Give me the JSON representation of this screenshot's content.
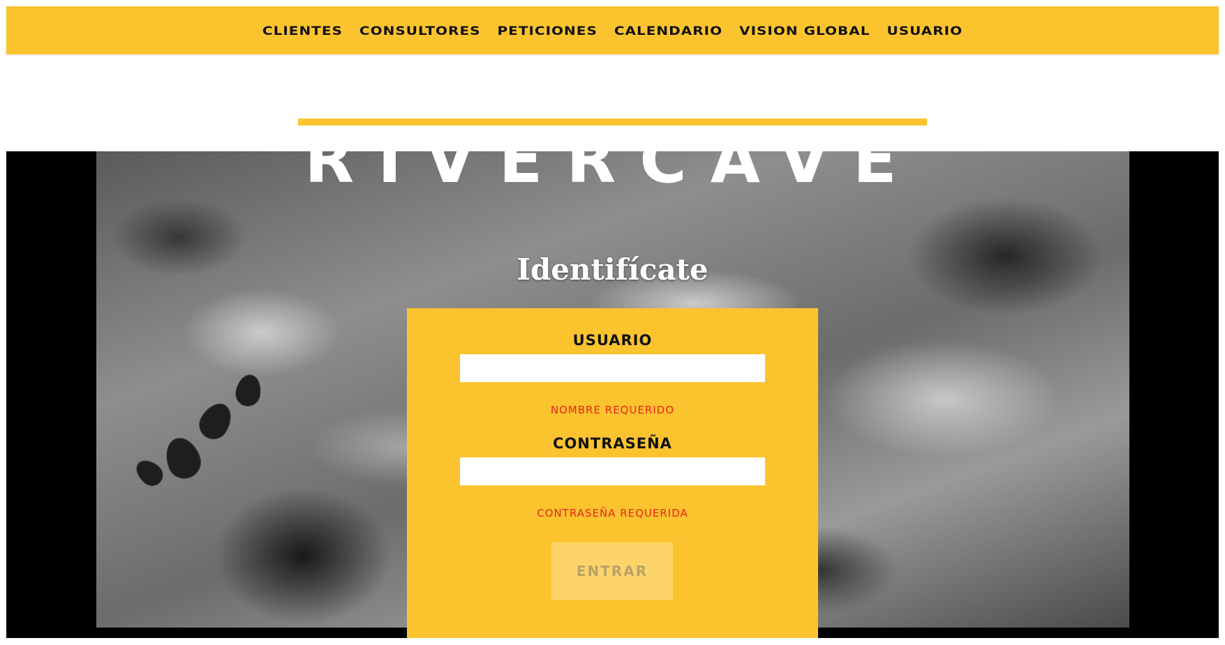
{
  "nav": {
    "items": [
      {
        "label": "Clientes"
      },
      {
        "label": "Consultores"
      },
      {
        "label": "Peticiones"
      },
      {
        "label": "Calendario"
      },
      {
        "label": "Vision global"
      },
      {
        "label": "Usuario"
      }
    ]
  },
  "brand": {
    "name": "RIVERCAVE"
  },
  "login": {
    "title": "Identifícate",
    "username_label": "Usuario",
    "username_value": "",
    "username_error": "Nombre requerido",
    "password_label": "Contraseña",
    "password_value": "",
    "password_error": "Contraseña requerida",
    "submit_label": "Entrar"
  },
  "colors": {
    "accent": "#fbc42f",
    "error": "#e8231d",
    "button_disabled_bg": "#fcd46a",
    "button_disabled_text": "#b8a36a"
  }
}
